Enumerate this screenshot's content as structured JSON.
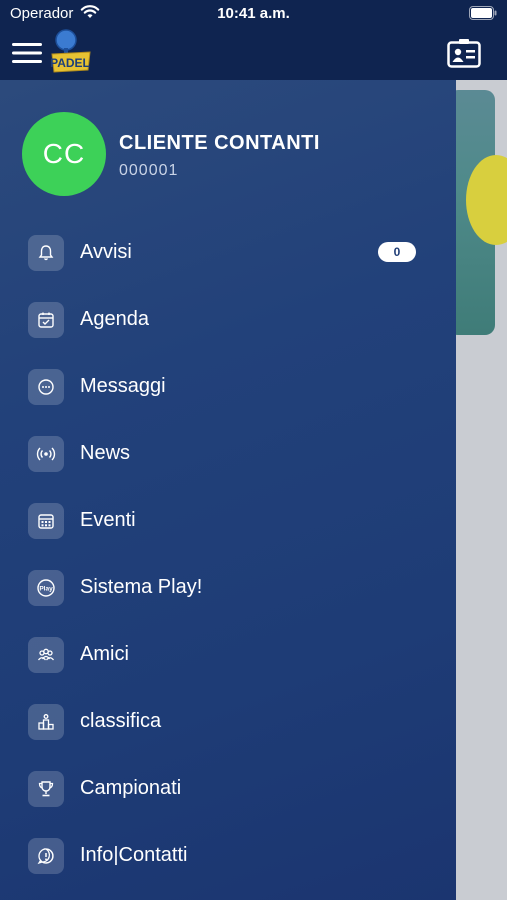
{
  "status_bar": {
    "carrier": "Operador",
    "time": "10:41 a.m."
  },
  "header": {
    "menu_icon": "hamburger-icon",
    "logo_text": "PADEL",
    "right_icon": "contact-card-icon"
  },
  "user": {
    "initials": "CC",
    "name": "CLIENTE CONTANTI",
    "code": "000001",
    "avatar_color": "#3dd158"
  },
  "menu": {
    "items": [
      {
        "label": "Avvisi",
        "icon": "bell-icon",
        "badge": "0"
      },
      {
        "label": "Agenda",
        "icon": "calendar-check-icon"
      },
      {
        "label": "Messaggi",
        "icon": "chat-bubble-icon"
      },
      {
        "label": "News",
        "icon": "broadcast-icon"
      },
      {
        "label": "Eventi",
        "icon": "calendar-grid-icon"
      },
      {
        "label": "Sistema Play!",
        "icon": "play-logo-icon"
      },
      {
        "label": "Amici",
        "icon": "friends-icon"
      },
      {
        "label": "classifica",
        "icon": "podium-icon"
      },
      {
        "label": "Campionati",
        "icon": "trophy-icon"
      },
      {
        "label": "Info|Contatti",
        "icon": "info-bubble-icon"
      }
    ]
  },
  "colors": {
    "navbar": "#0f2450",
    "drawer": "#1e3c76",
    "badge_bg": "#ffffff"
  }
}
